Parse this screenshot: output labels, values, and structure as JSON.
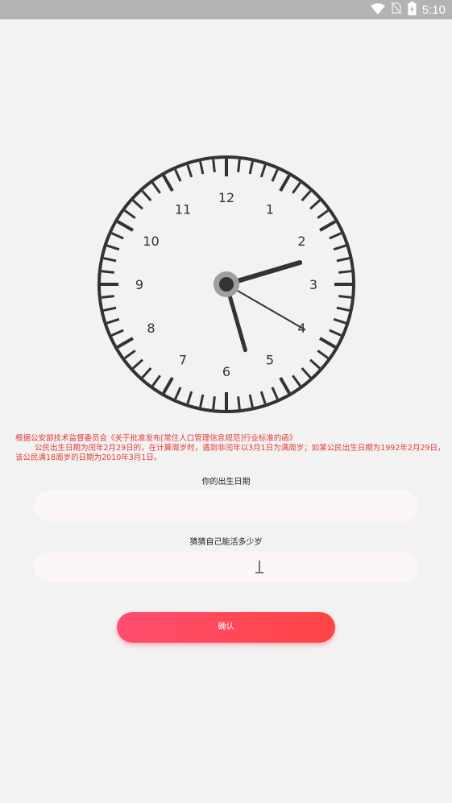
{
  "status_bar": {
    "time": "5:10",
    "icons": [
      "wifi-icon",
      "no-sim-icon",
      "battery-charging-icon"
    ]
  },
  "clock": {
    "numerals": [
      "12",
      "1",
      "2",
      "3",
      "4",
      "5",
      "6",
      "7",
      "8",
      "9",
      "10",
      "11"
    ],
    "time": {
      "hour": 2,
      "minute": 27,
      "second": 20
    },
    "colors": {
      "ink": "#333333",
      "center_ring": "#9e9e9e"
    }
  },
  "notice": {
    "line1": "根据公安部技术监督委员会《关于批准发布[常住人口管理信息规范]行业标准的函》",
    "line2": "公民出生日期为闰年2月29日的，在计算周岁时，遇到非闰年以3月1日为满周岁；如某公民出生日期为1992年2月29日，",
    "line3": "该公民满18周岁的日期为2010年3月1日。",
    "color": "#e53935"
  },
  "form": {
    "birth_label": "你的出生日期",
    "birth_value": "",
    "guess_label": "猜猜自己能活多少岁",
    "guess_value": "",
    "field_bg": "#fdf6f6"
  },
  "confirm_button": {
    "label": "确认",
    "gradient": [
      "#ff4d70",
      "#ff4444"
    ]
  }
}
